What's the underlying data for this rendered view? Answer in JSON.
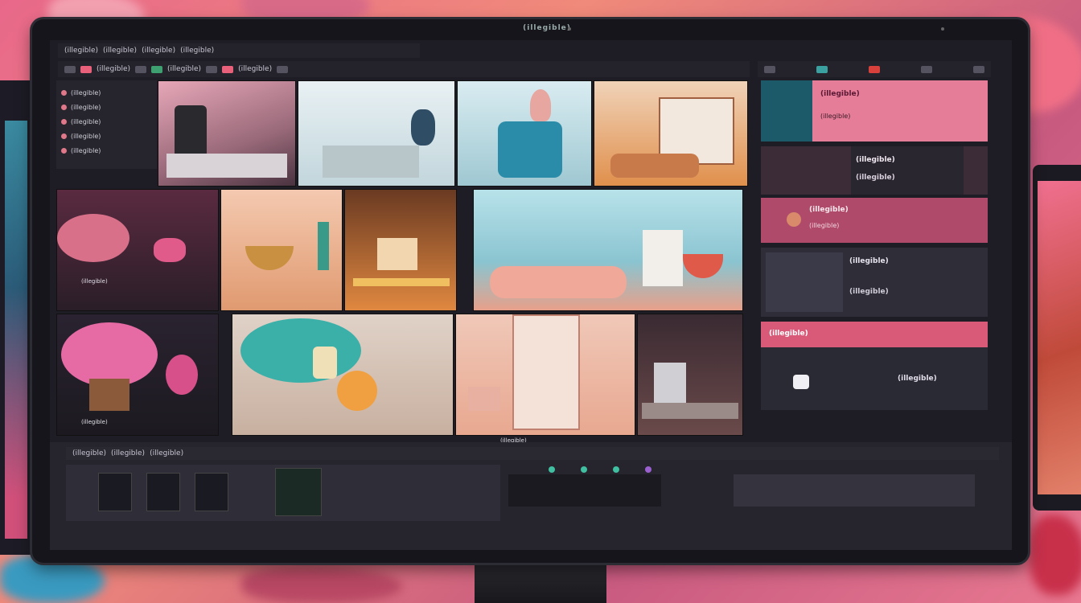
{
  "scene": {
    "monitor_brand": "(illegible)",
    "colors": {
      "wall": "#e8688a",
      "bezel": "#15151b",
      "ui_bg": "#1e1d26",
      "accent_pink": "#e8607a",
      "accent_teal": "#3aa0a0"
    }
  },
  "toolbar": {
    "menu_items": [
      "(illegible)",
      "(illegible)",
      "(illegible)",
      "(illegible)"
    ],
    "tool_labels": [
      "(illegible)",
      "(illegible)",
      "(illegible)"
    ]
  },
  "sidebar": {
    "items": [
      "(illegible)",
      "(illegible)",
      "(illegible)",
      "(illegible)",
      "(illegible)"
    ]
  },
  "grid": {
    "tiles": [
      {
        "subject": "bedroom-lamp"
      },
      {
        "subject": "white-room-vase"
      },
      {
        "subject": "figure-in-chair"
      },
      {
        "subject": "wooden-shelf-interior"
      },
      {
        "subject": "pink-sponge-rock"
      },
      {
        "subject": "candle-basket-still-life"
      },
      {
        "subject": "warm-desk-scene"
      },
      {
        "subject": "blue-room-bowl"
      },
      {
        "subject": "pink-tree"
      },
      {
        "subject": "teal-flowers-jar"
      },
      {
        "subject": "shelf-boxes"
      },
      {
        "subject": "dark-kitchen"
      }
    ],
    "captions": [
      "(illegible)",
      "(illegible)",
      "(illegible)"
    ]
  },
  "right_panel": {
    "icons": [
      "square-icon",
      "chat-icon",
      "record-icon",
      "list-icon",
      "grid-icon"
    ],
    "cards": [
      {
        "title": "(illegible)",
        "subtitle": "(illegible)"
      },
      {
        "title": "(illegible)",
        "subtitle": "(illegible)"
      },
      {
        "title": "(illegible)",
        "subtitle": "(illegible)"
      },
      {
        "title": "(illegible)",
        "subtitle": "(illegible)"
      },
      {
        "title": "(illegible)",
        "subtitle": "(illegible)"
      }
    ]
  },
  "timeline": {
    "track_labels": [
      "(illegible)",
      "(illegible)",
      "(illegible)"
    ],
    "clips": [
      "figure-clip",
      "figure-clip",
      "figure-clip",
      "plant-clip"
    ]
  }
}
